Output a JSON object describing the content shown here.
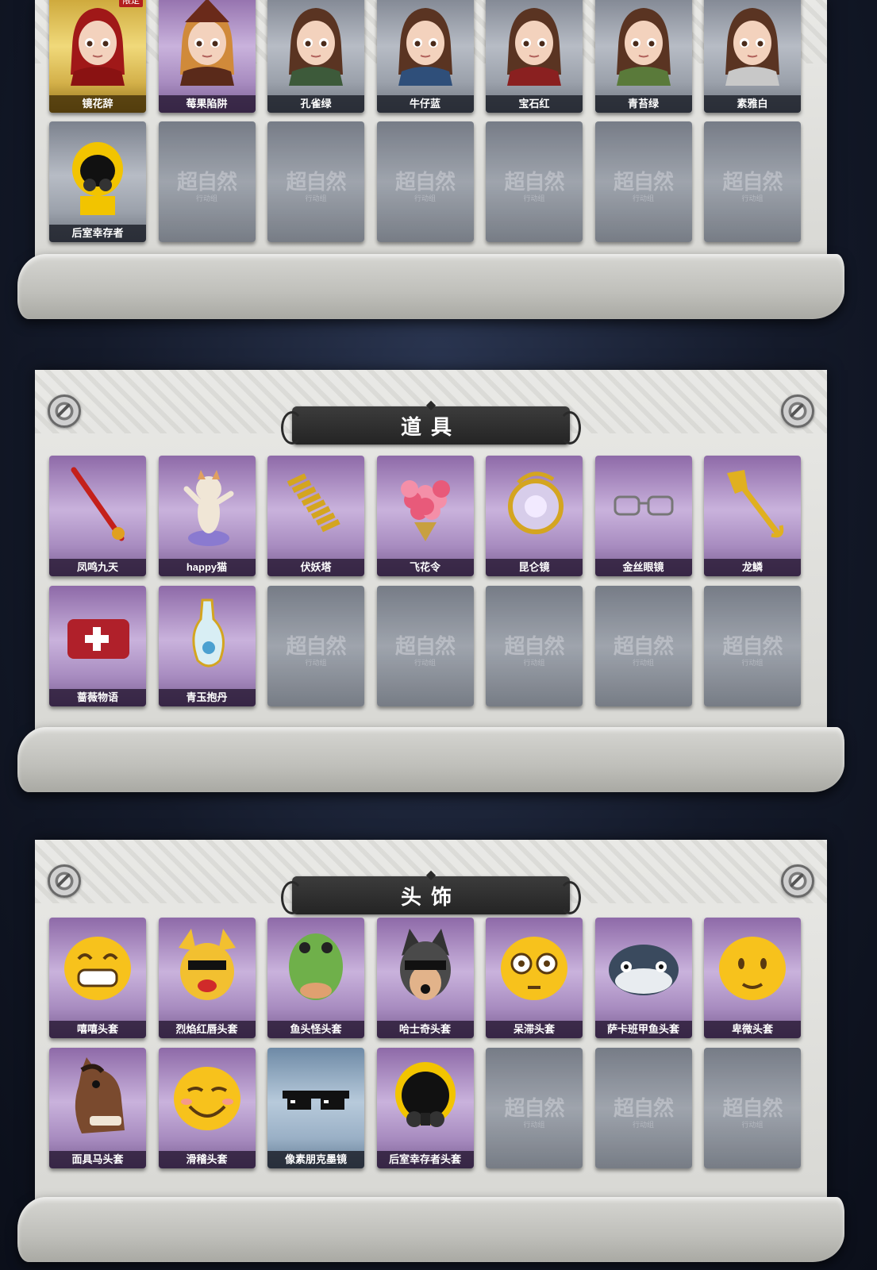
{
  "sections": [
    {
      "id": "costumes",
      "title": "",
      "rows": [
        [
          {
            "label": "镜花辞",
            "tier": "gold",
            "badge": "限定",
            "icon": "red-hooded-girl-portrait"
          },
          {
            "label": "莓果陷阱",
            "tier": "purple",
            "icon": "witch-hat-portrait"
          },
          {
            "label": "孔雀绿",
            "tier": "grey",
            "icon": "girl-portrait-green"
          },
          {
            "label": "牛仔蓝",
            "tier": "grey",
            "icon": "girl-portrait-blue"
          },
          {
            "label": "宝石红",
            "tier": "grey",
            "icon": "girl-portrait-red"
          },
          {
            "label": "青苔绿",
            "tier": "grey",
            "icon": "girl-portrait-moss"
          },
          {
            "label": "素雅白",
            "tier": "grey",
            "icon": "girl-portrait-white"
          }
        ],
        [
          {
            "label": "后室幸存者",
            "tier": "grey",
            "icon": "gas-mask-survivor-portrait"
          },
          {
            "empty": true
          },
          {
            "empty": true
          },
          {
            "empty": true
          },
          {
            "empty": true
          },
          {
            "empty": true
          },
          {
            "empty": true
          }
        ]
      ]
    },
    {
      "id": "items",
      "title": "道具",
      "rows": [
        [
          {
            "label": "凤鸣九天",
            "tier": "purple",
            "icon": "red-sword-icon"
          },
          {
            "label": "happy猫",
            "tier": "purple",
            "icon": "dancing-cat-icon"
          },
          {
            "label": "伏妖塔",
            "tier": "purple",
            "icon": "golden-pagoda-icon"
          },
          {
            "label": "飞花令",
            "tier": "purple",
            "icon": "flower-bouquet-icon"
          },
          {
            "label": "昆仑镜",
            "tier": "purple",
            "icon": "ornate-mirror-icon"
          },
          {
            "label": "金丝眼镜",
            "tier": "purple",
            "icon": "glasses-icon"
          },
          {
            "label": "龙鳞",
            "tier": "purple",
            "icon": "golden-shovel-icon"
          }
        ],
        [
          {
            "label": "蔷薇物语",
            "tier": "purple",
            "icon": "first-aid-kit-icon"
          },
          {
            "label": "青玉抱丹",
            "tier": "purple",
            "icon": "jade-vase-icon"
          },
          {
            "empty": true
          },
          {
            "empty": true
          },
          {
            "empty": true
          },
          {
            "empty": true
          },
          {
            "empty": true
          }
        ]
      ]
    },
    {
      "id": "headwear",
      "title": "头饰",
      "rows": [
        [
          {
            "label": "嘻嘻头套",
            "tier": "purple",
            "icon": "grin-emoji-head-icon"
          },
          {
            "label": "烈焰红唇头套",
            "tier": "purple",
            "icon": "yellow-mascot-sunglasses-icon"
          },
          {
            "label": "鱼头怪头套",
            "tier": "purple",
            "icon": "fish-head-icon"
          },
          {
            "label": "哈士奇头套",
            "tier": "purple",
            "icon": "husky-head-sunglasses-icon"
          },
          {
            "label": "呆滞头套",
            "tier": "purple",
            "icon": "dazed-emoji-head-icon"
          },
          {
            "label": "萨卡班甲鱼头套",
            "tier": "purple",
            "icon": "sacabambaspis-head-icon"
          },
          {
            "label": "卑微头套",
            "tier": "purple",
            "icon": "humble-emoji-head-icon"
          }
        ],
        [
          {
            "label": "面具马头套",
            "tier": "purple",
            "icon": "horse-mask-icon"
          },
          {
            "label": "滑稽头套",
            "tier": "purple",
            "icon": "funny-emoji-head-icon"
          },
          {
            "label": "像素朋克墨镜",
            "tier": "blue",
            "icon": "pixel-sunglasses-icon"
          },
          {
            "label": "后室幸存者头套",
            "tier": "purple",
            "icon": "gas-mask-helmet-icon"
          },
          {
            "empty": true
          },
          {
            "empty": true
          },
          {
            "empty": true
          }
        ]
      ]
    }
  ],
  "placeholder": {
    "watermark": "超自然",
    "watermark_sub": "行动组"
  },
  "colors": {
    "banner": "#2e2e2e",
    "label_text": "#ffffff",
    "badge": "#b21e1e"
  }
}
